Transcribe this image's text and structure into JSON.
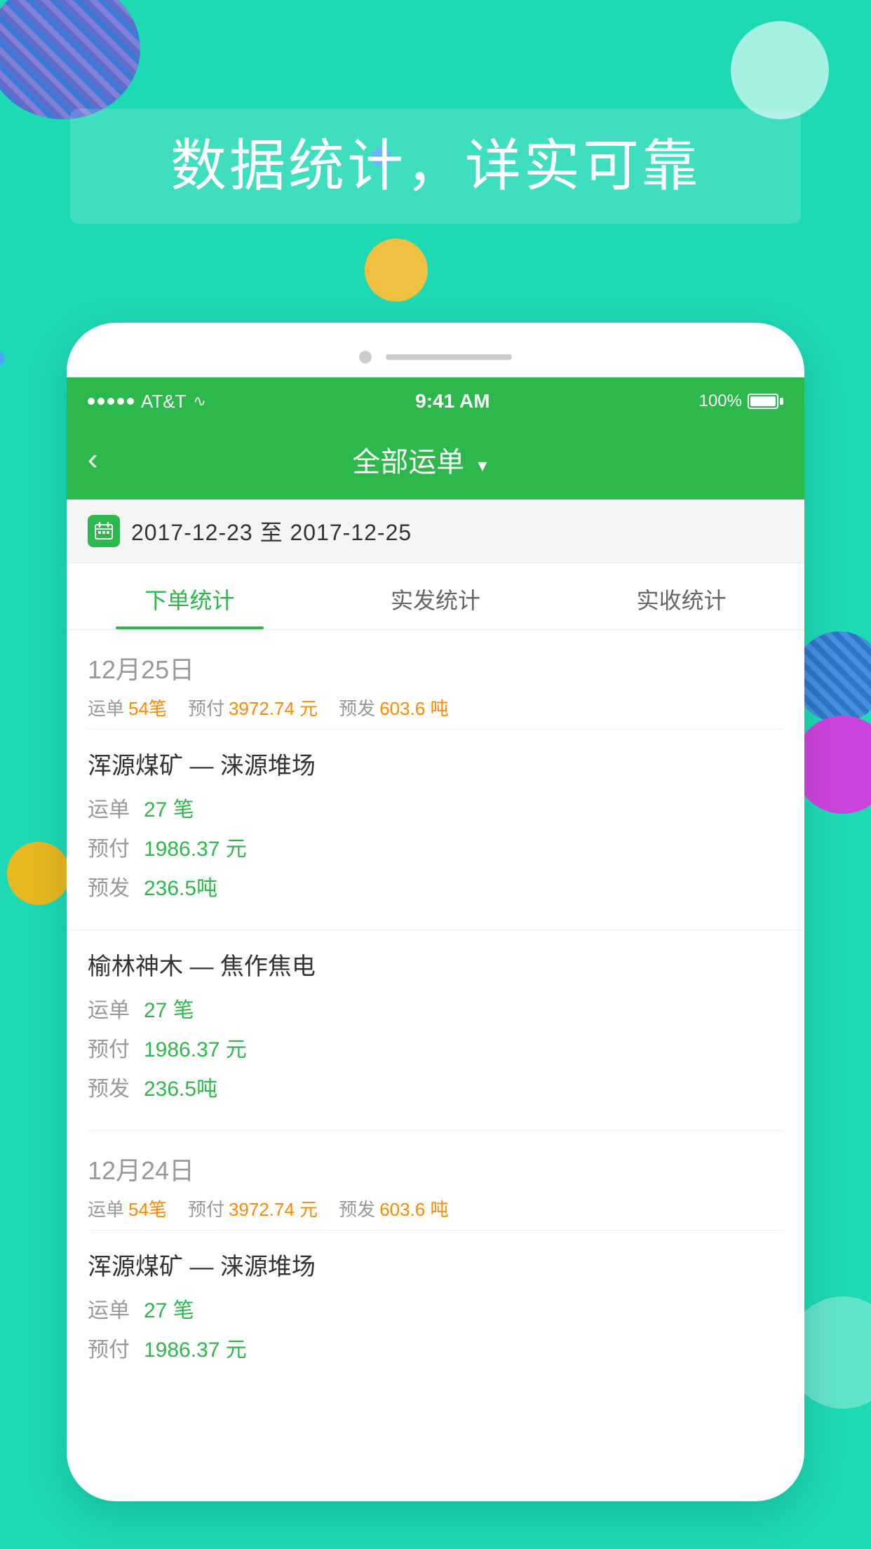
{
  "background": {
    "color": "#1dd9b4"
  },
  "headline": {
    "text": "数据统计，详实可靠"
  },
  "phone": {
    "statusBar": {
      "carrier": "AT&T",
      "time": "9:41 AM",
      "battery": "100%"
    },
    "navBar": {
      "backLabel": "‹",
      "title": "全部运单",
      "dropdown": "▾"
    },
    "dateFilter": {
      "dateRange": "2017-12-23 至  2017-12-25"
    },
    "tabs": [
      {
        "label": "下单统计",
        "active": true
      },
      {
        "label": "实发统计",
        "active": false
      },
      {
        "label": "实收统计",
        "active": false
      }
    ],
    "sections": [
      {
        "date": "12月25日",
        "summary": {
          "orderLabel": "运单",
          "orderValue": "54笔",
          "prepayLabel": "预付",
          "prepayValue": "3972.74 元",
          "preshipLabel": "预发",
          "preshipValue": "603.6 吨"
        },
        "routes": [
          {
            "name": "浑源煤矿 — 涞源堆场",
            "stats": [
              {
                "label": "运单",
                "value": "27 笔"
              },
              {
                "label": "预付",
                "value": "1986.37 元"
              },
              {
                "label": "预发",
                "value": "236.5吨"
              }
            ]
          },
          {
            "name": "榆林神木 — 焦作焦电",
            "stats": [
              {
                "label": "运单",
                "value": "27 笔"
              },
              {
                "label": "预付",
                "value": "1986.37 元"
              },
              {
                "label": "预发",
                "value": "236.5吨"
              }
            ]
          }
        ]
      },
      {
        "date": "12月24日",
        "summary": {
          "orderLabel": "运单",
          "orderValue": "54笔",
          "prepayLabel": "预付",
          "prepayValue": "3972.74 元",
          "preshipLabel": "预发",
          "preshipValue": "603.6 吨"
        },
        "routes": [
          {
            "name": "浑源煤矿 — 涞源堆场",
            "stats": [
              {
                "label": "运单",
                "value": "27 笔"
              },
              {
                "label": "预付",
                "value": "1986.37 元"
              }
            ]
          }
        ]
      }
    ]
  }
}
